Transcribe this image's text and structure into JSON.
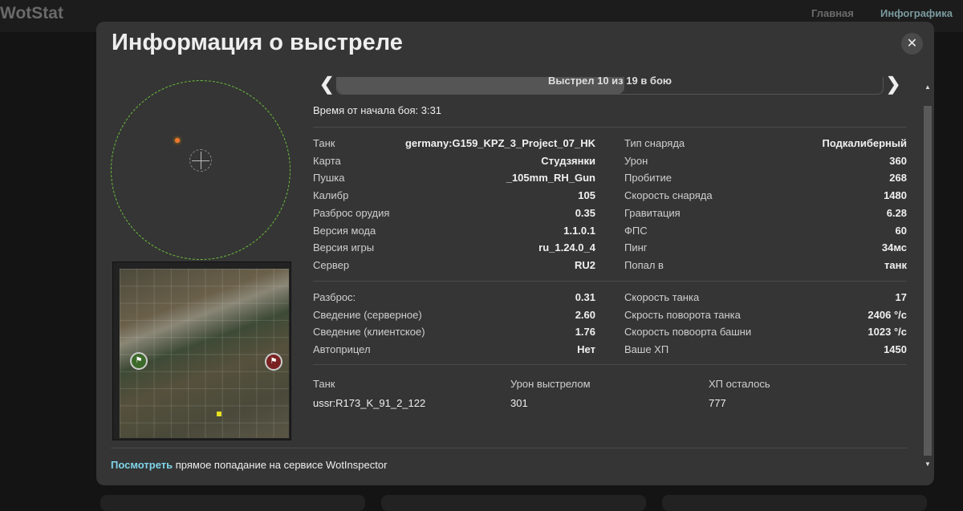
{
  "header": {
    "logo": "WotStat",
    "nav": [
      "Главная",
      "Инфографика"
    ]
  },
  "modal": {
    "title": "Информация о выстреле",
    "close": "✕"
  },
  "slider": {
    "label": "Выстрел 10 из 19 в бою",
    "current": 10,
    "total": 19
  },
  "time": "Время от начала боя: 3:31",
  "left_rows": [
    [
      "Танк",
      "germany:G159_KPZ_3_Project_07_HK"
    ],
    [
      "Карта",
      "Студзянки"
    ],
    [
      "Пушка",
      "_105mm_RH_Gun"
    ],
    [
      "Калибр",
      "105"
    ],
    [
      "Разброс орудия",
      "0.35"
    ],
    [
      "Версия мода",
      "1.1.0.1"
    ],
    [
      "Версия игры",
      "ru_1.24.0_4"
    ],
    [
      "Сервер",
      "RU2"
    ]
  ],
  "right_rows": [
    [
      "Тип снаряда",
      "Подкалиберный"
    ],
    [
      "Урон",
      "360"
    ],
    [
      "Пробитие",
      "268"
    ],
    [
      "Скорость снаряда",
      "1480"
    ],
    [
      "Гравитация",
      "6.28"
    ],
    [
      "ФПС",
      "60"
    ],
    [
      "Пинг",
      "34мс"
    ],
    [
      "Попал в",
      "танк"
    ]
  ],
  "left_rows2": [
    [
      "Разброс:",
      "0.31"
    ],
    [
      "Сведение (серверное)",
      "2.60"
    ],
    [
      "Сведение (клиентское)",
      "1.76"
    ],
    [
      "Автоприцел",
      "Нет"
    ]
  ],
  "right_rows2": [
    [
      "Скорость танка",
      "17"
    ],
    [
      "Скрость поворота танка",
      "2406 °/c"
    ],
    [
      "Скорость повоорта башни",
      "1023 °/c"
    ],
    [
      "Ваше ХП",
      "1450"
    ]
  ],
  "target": {
    "headers": [
      "Танк",
      "Урон выстрелом",
      "ХП осталось"
    ],
    "values": [
      "ussr:R173_K_91_2_122",
      "301",
      "777"
    ]
  },
  "footer": {
    "link": "Посмотреть",
    "text": " прямое попадание на сервисе WotInspector"
  }
}
